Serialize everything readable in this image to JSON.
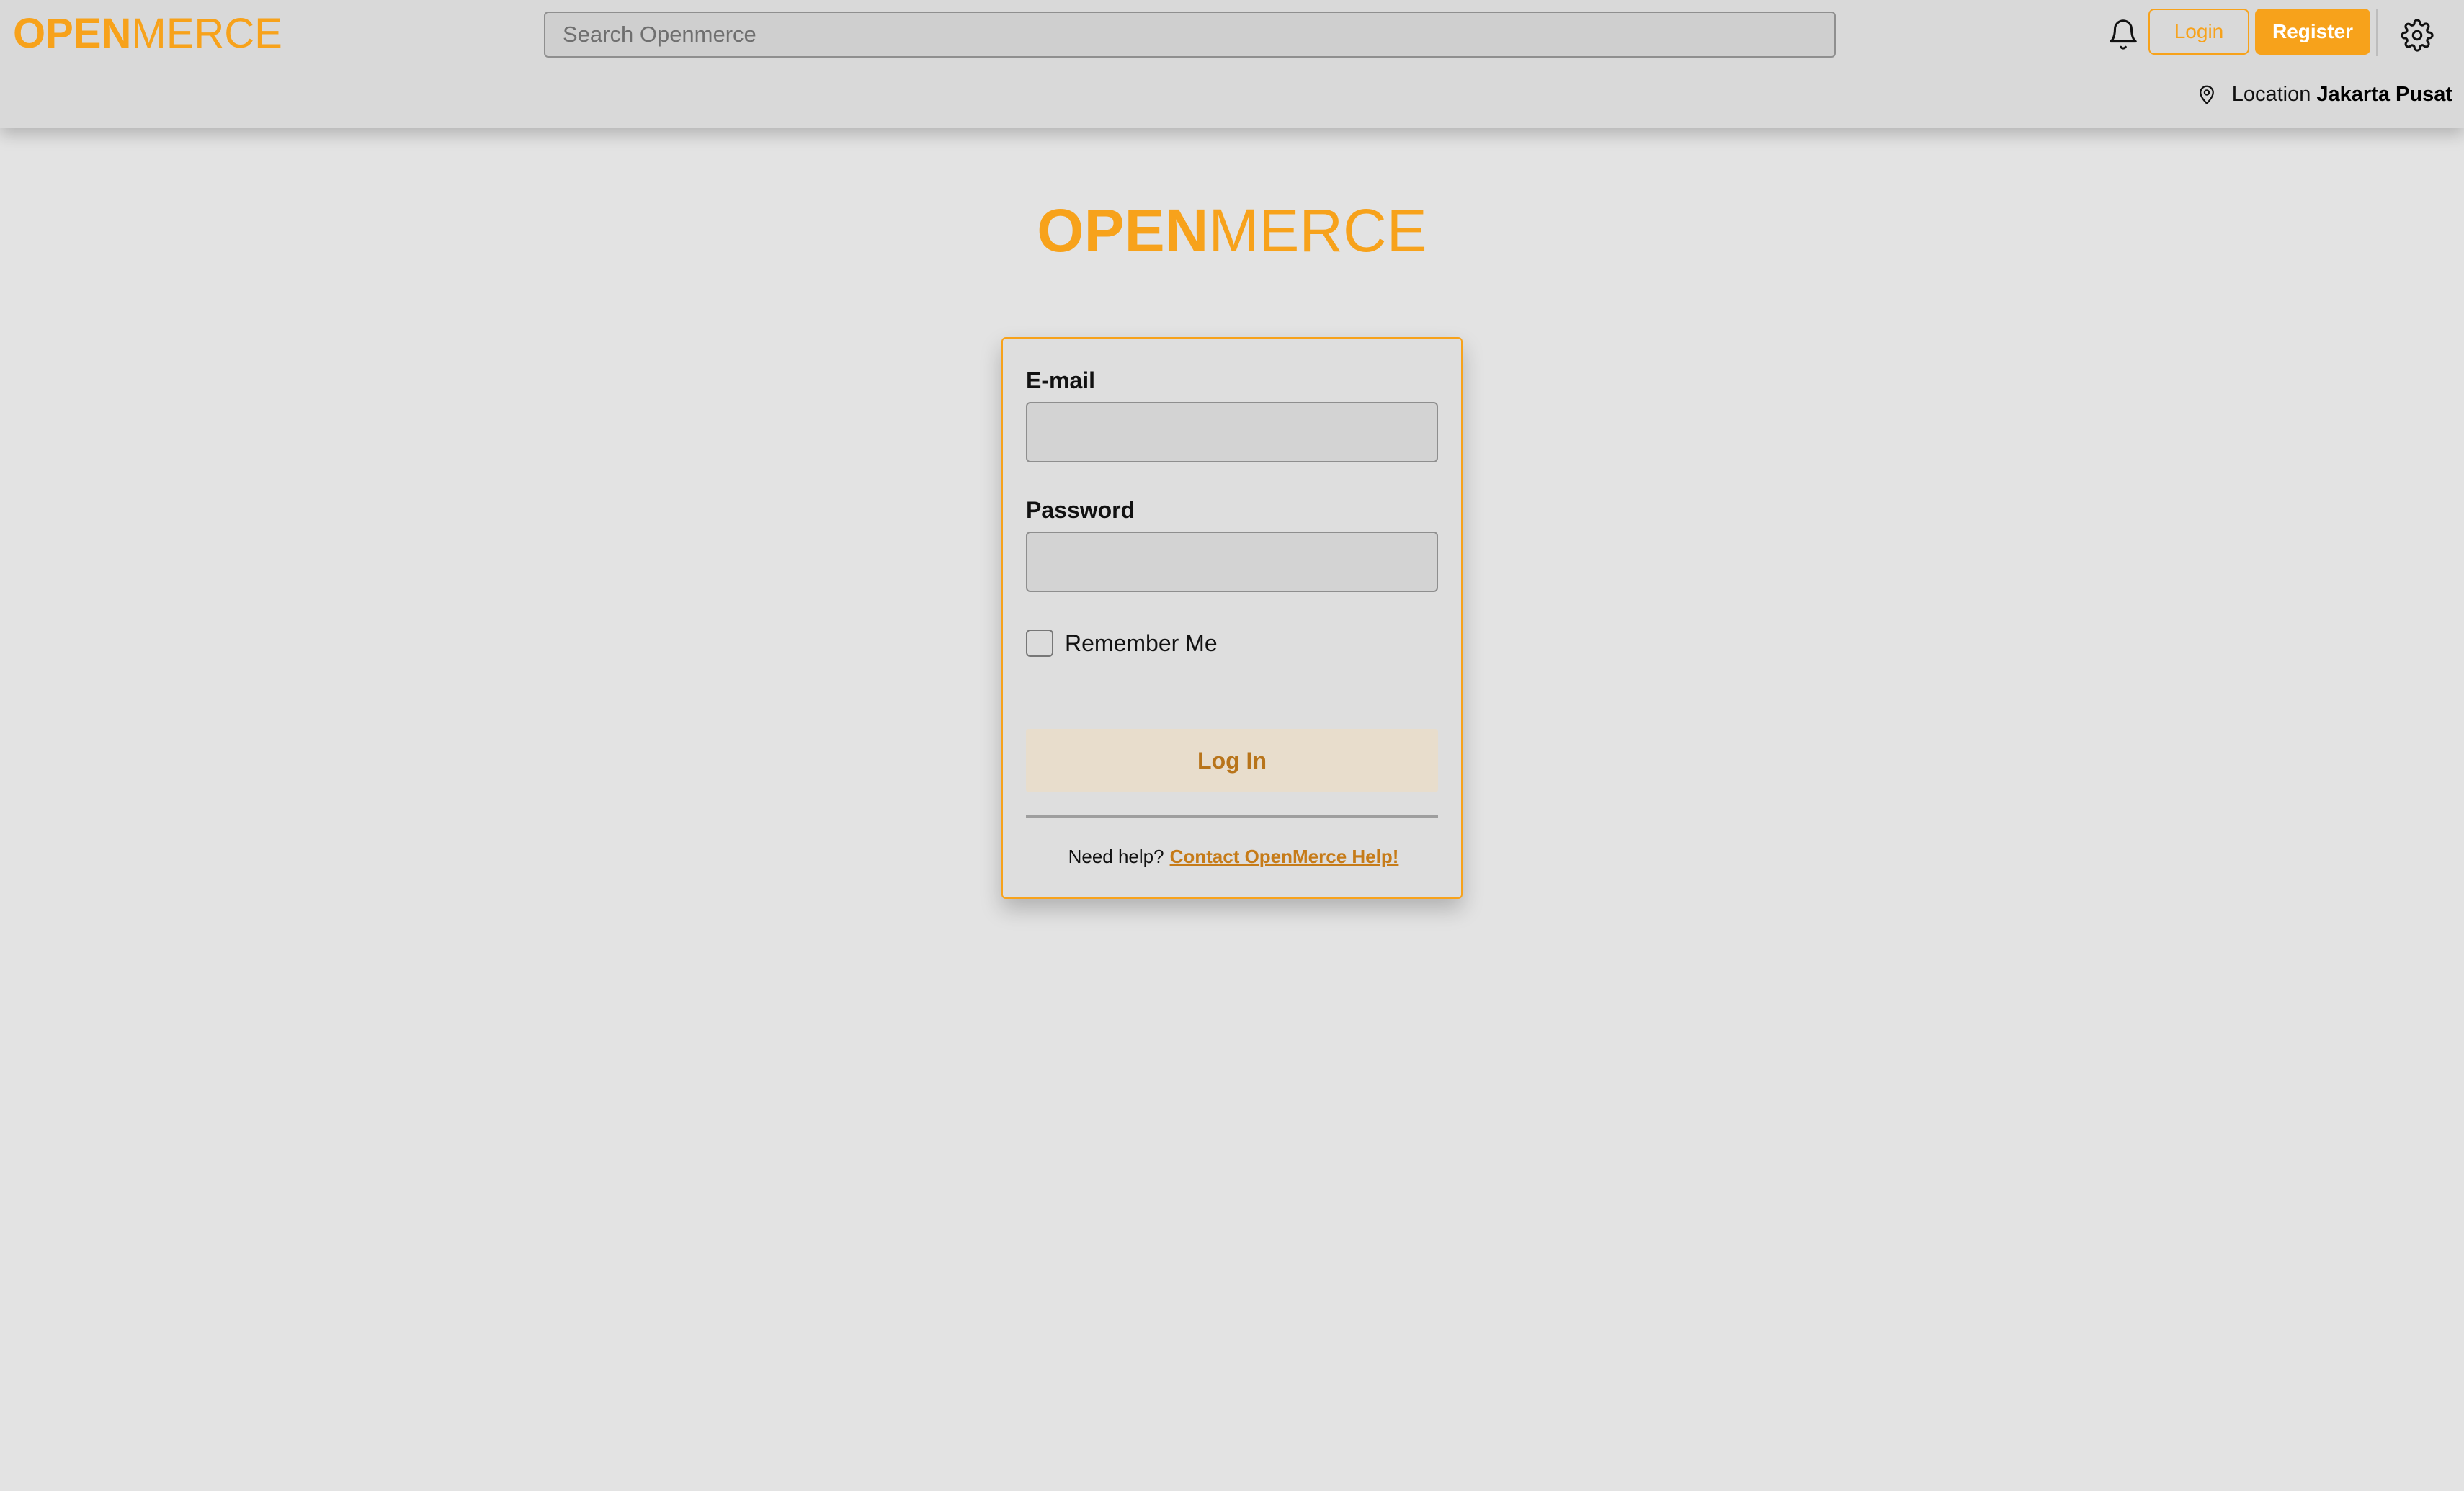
{
  "header": {
    "brand_part1": "OPEN",
    "brand_part2": "MERCE",
    "search_placeholder": "Search Openmerce",
    "login_label": "Login",
    "register_label": "Register",
    "location_label": "Location",
    "location_city": "Jakarta Pusat"
  },
  "main": {
    "brand_part1": "OPEN",
    "brand_part2": "MERCE",
    "email_label": "E-mail",
    "email_value": "",
    "password_label": "Password",
    "password_value": "",
    "remember_label": "Remember Me",
    "remember_checked": false,
    "login_button_label": "Log In",
    "help_text": "Need help?",
    "help_link": "Contact OpenMerce Help!"
  },
  "icons": {
    "bell": "bell-icon",
    "gear": "gear-icon",
    "pin": "location-pin-icon"
  },
  "colors": {
    "accent": "#f7a21b",
    "login_button_bg": "#e8ddcc",
    "login_button_text": "#b8741a",
    "link": "#c67b18",
    "background": "#e3e3e3",
    "header_bg": "#d9d9d9"
  }
}
